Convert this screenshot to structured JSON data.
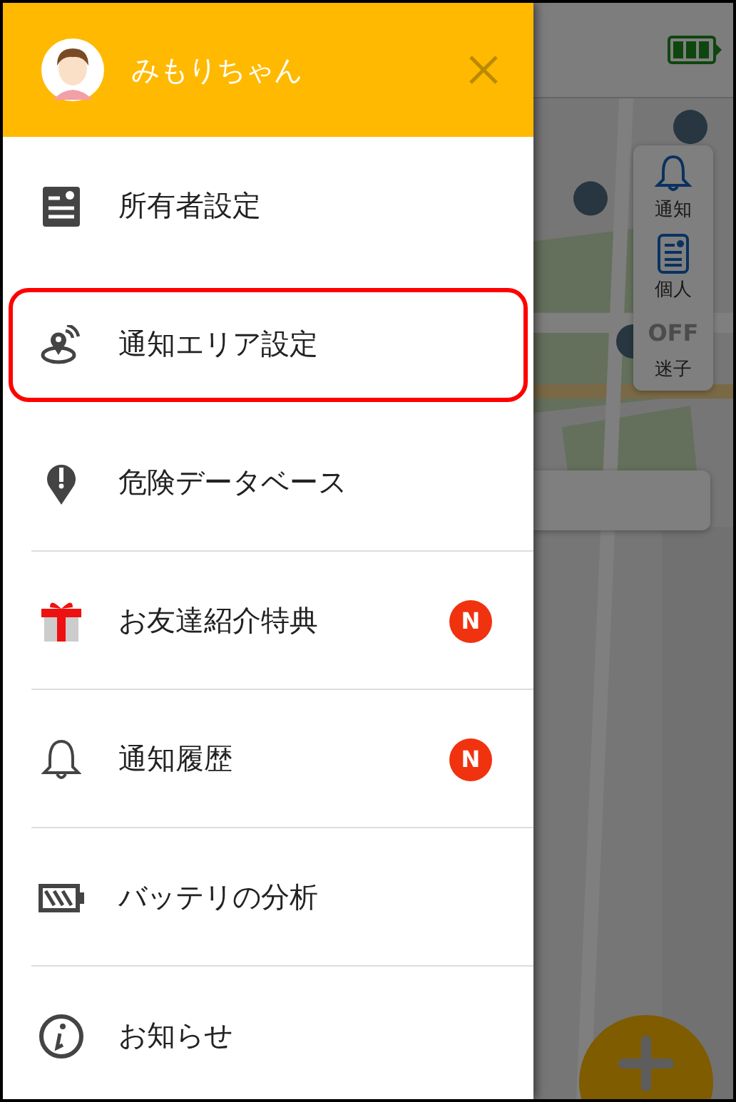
{
  "header": {
    "user_name": "みもりちゃん"
  },
  "menu": [
    {
      "label": "所有者設定",
      "kind": "owner",
      "highlighted": false,
      "divider": false
    },
    {
      "label": "通知エリア設定",
      "kind": "area",
      "highlighted": true,
      "divider": false
    },
    {
      "label": "危険データベース",
      "kind": "danger",
      "highlighted": false,
      "divider": true
    },
    {
      "label": "お友達紹介特典",
      "kind": "gift",
      "highlighted": false,
      "divider": true,
      "badge": "N"
    },
    {
      "label": "通知履歴",
      "kind": "bell",
      "highlighted": false,
      "divider": true,
      "badge": "N"
    },
    {
      "label": "バッテリの分析",
      "kind": "battery",
      "highlighted": false,
      "divider": true
    },
    {
      "label": "お知らせ",
      "kind": "info",
      "highlighted": false,
      "divider": false
    }
  ],
  "map_panel": {
    "buttons": [
      {
        "label": "通知",
        "kind": "bell"
      },
      {
        "label": "個人",
        "kind": "profile"
      },
      {
        "label": "迷子",
        "kind": "lost",
        "icon_text": "OFF"
      }
    ]
  }
}
